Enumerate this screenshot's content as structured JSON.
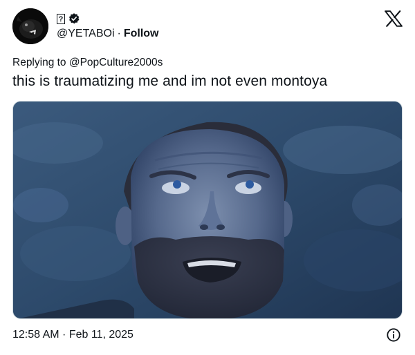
{
  "author": {
    "display_name": "?",
    "handle": "@YETABOi",
    "separator": "·",
    "follow_label": "Follow",
    "avatar_icon": "dark-creature-avatar",
    "verified_icon": "verified-badge-icon"
  },
  "reply": {
    "prefix": "Replying to",
    "mention": "@PopCulture2000s"
  },
  "tweet": {
    "text": "this is traumatizing me and im not even montoya",
    "media_icon": "man-looking-up-photo"
  },
  "footer": {
    "timestamp": "12:58 AM · Feb 11, 2025",
    "info_icon": "info-icon"
  },
  "colors": {
    "text": "#0f1419",
    "muted": "#536471",
    "border": "#cfd9de",
    "photo_tint": "#2c4867"
  }
}
